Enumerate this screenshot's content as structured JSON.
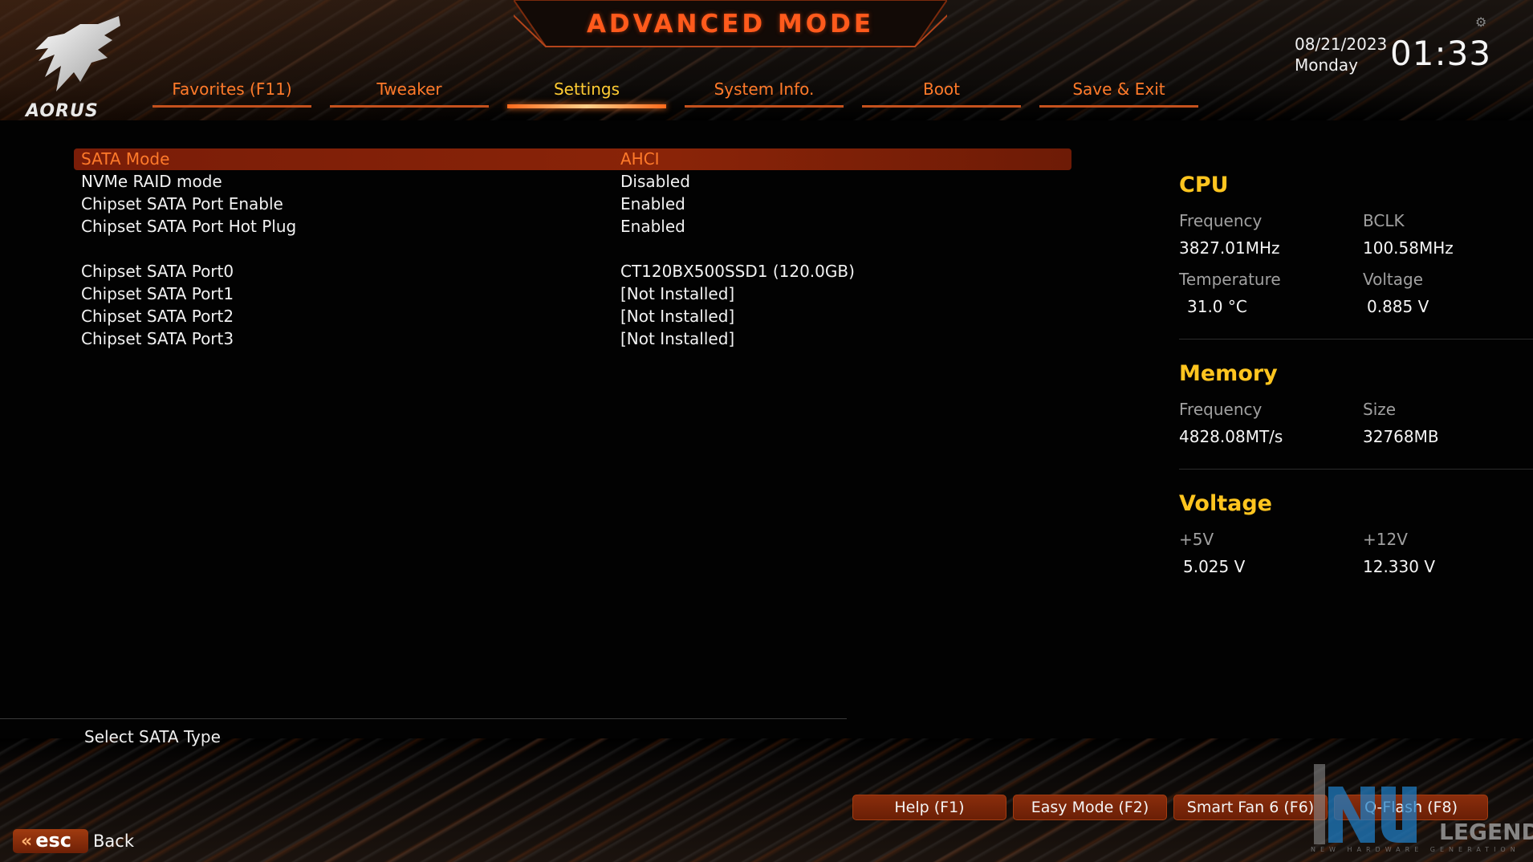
{
  "header": {
    "title": "ADVANCED MODE",
    "date": "08/21/2023",
    "day": "Monday",
    "time": "01:33",
    "logo_text": "AORUS"
  },
  "tabs": [
    {
      "label": "Favorites (F11)",
      "active": false
    },
    {
      "label": "Tweaker",
      "active": false
    },
    {
      "label": "Settings",
      "active": true
    },
    {
      "label": "System Info.",
      "active": false
    },
    {
      "label": "Boot",
      "active": false
    },
    {
      "label": "Save & Exit",
      "active": false
    }
  ],
  "settings": [
    {
      "label": "SATA Mode",
      "value": "AHCI",
      "selected": true
    },
    {
      "label": "NVMe RAID mode",
      "value": "Disabled"
    },
    {
      "label": "Chipset SATA Port Enable",
      "value": "Enabled"
    },
    {
      "label": "Chipset SATA Port Hot Plug",
      "value": "Enabled"
    },
    {
      "label": "Chipset SATA Port0",
      "value": "CT120BX500SSD1 (120.0GB)"
    },
    {
      "label": "Chipset SATA Port1",
      "value": "[Not Installed]"
    },
    {
      "label": "Chipset SATA Port2",
      "value": "[Not Installed]"
    },
    {
      "label": "Chipset SATA Port3",
      "value": "[Not Installed]"
    }
  ],
  "help_text": "Select SATA Type",
  "panel": {
    "cpu": {
      "title": "CPU",
      "frequency_label": "Frequency",
      "frequency": "3827.01MHz",
      "bclk_label": "BCLK",
      "bclk": "100.58MHz",
      "temperature_label": "Temperature",
      "temperature": "31.0 °C",
      "voltage_label": "Voltage",
      "voltage": "0.885 V"
    },
    "memory": {
      "title": "Memory",
      "frequency_label": "Frequency",
      "frequency": "4828.08MT/s",
      "size_label": "Size",
      "size": "32768MB"
    },
    "voltage": {
      "title": "Voltage",
      "v5_label": "+5V",
      "v5": "5.025 V",
      "v12_label": "+12V",
      "v12": "12.330 V"
    }
  },
  "footer": {
    "buttons": [
      "Help (F1)",
      "Easy Mode (F2)",
      "Smart Fan 6 (F6)",
      "Q-Flash (F8)"
    ],
    "esc_label": "esc",
    "back_label": "Back"
  },
  "watermark": {
    "text": "LEGEND",
    "subtext": "NEW HARDWARE GENERATION"
  },
  "colors": {
    "accent": "#ff7a2a",
    "active_tab": "#ffcc33",
    "section_title": "#ffc51f",
    "selected_row": "#8a2408"
  }
}
